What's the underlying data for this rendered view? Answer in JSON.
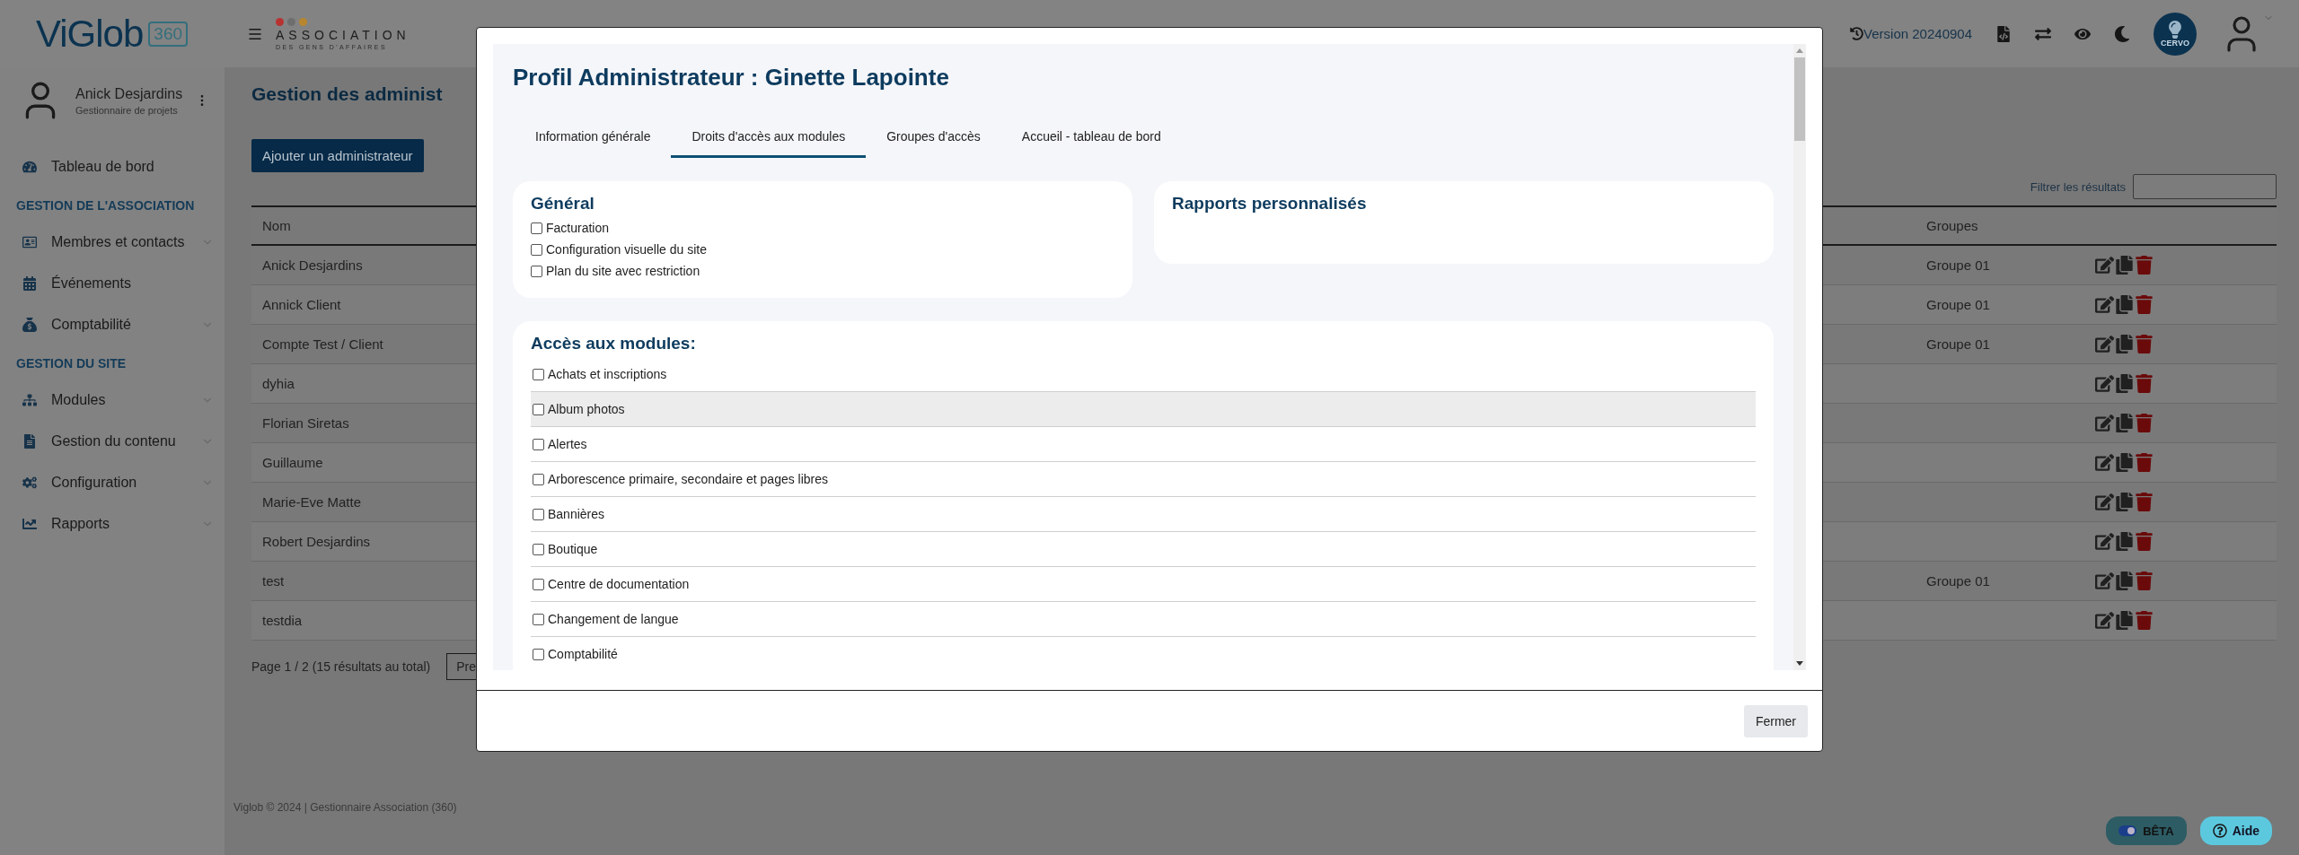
{
  "header": {
    "logo": {
      "name": "ViGlob",
      "badge": "360"
    },
    "org_logo": {
      "title": "ASSOCIATION",
      "subtitle": "DES GENS D'AFFAIRES",
      "dots": [
        {
          "color": "#b83232"
        },
        {
          "color": "#6e6e6e"
        },
        {
          "color": "#b8862e"
        }
      ]
    },
    "version": "Version 20240904",
    "assistant_badge": "CERVO"
  },
  "user": {
    "name": "Anick Desjardins",
    "role": "Gestionnaire de projets"
  },
  "sidebar": {
    "items": [
      {
        "kind": "link",
        "label": "Tableau de bord",
        "expandable": false
      },
      {
        "kind": "section",
        "label": "GESTION DE L'ASSOCIATION"
      },
      {
        "kind": "link",
        "label": "Membres et contacts",
        "expandable": true
      },
      {
        "kind": "link",
        "label": "Événements",
        "expandable": false
      },
      {
        "kind": "link",
        "label": "Comptabilité",
        "expandable": true
      },
      {
        "kind": "section",
        "label": "GESTION DU SITE"
      },
      {
        "kind": "link",
        "label": "Modules",
        "expandable": true
      },
      {
        "kind": "link",
        "label": "Gestion du contenu",
        "expandable": true
      },
      {
        "kind": "link",
        "label": "Configuration",
        "expandable": true
      },
      {
        "kind": "link",
        "label": "Rapports",
        "expandable": true
      }
    ]
  },
  "page": {
    "title": "Gestion des administ",
    "add_button": "Ajouter un administrateur",
    "filter_label": "Filtrer les résultats",
    "table": {
      "columns": [
        "Nom",
        "Groupes"
      ],
      "rows": [
        {
          "name": "Anick Desjardins",
          "group": "Groupe 01"
        },
        {
          "name": "Annick Client",
          "group": "Groupe 01"
        },
        {
          "name": "Compte Test / Client",
          "group": "Groupe 01"
        },
        {
          "name": "dyhia"
        },
        {
          "name": "Florian Siretas"
        },
        {
          "name": "Guillaume"
        },
        {
          "name": "Marie-Eve Matte"
        },
        {
          "name": "Robert Desjardins"
        },
        {
          "name": "test",
          "group": "Groupe 01"
        },
        {
          "name": "testdia"
        }
      ]
    },
    "pagination": {
      "summary": "Page 1 / 2 (15 résultats au total)",
      "prev_button": "Pre"
    }
  },
  "footer": "Viglob © 2024 | Gestionnaire Association (360)",
  "beta_toggle": {
    "label": "BÊTA",
    "on": true
  },
  "help_button": "Aide",
  "modal": {
    "title": "Profil Administrateur : Ginette Lapointe",
    "tabs": [
      {
        "label": "Information générale",
        "selected": false
      },
      {
        "label": "Droits d'accès aux modules",
        "selected": true
      },
      {
        "label": "Groupes d'accès",
        "selected": false
      },
      {
        "label": "Accueil - tableau de bord",
        "selected": false
      }
    ],
    "general": {
      "title": "Général",
      "options": [
        {
          "label": "Facturation",
          "checked": false
        },
        {
          "label": "Configuration visuelle du site",
          "checked": false
        },
        {
          "label": "Plan du site avec restriction",
          "checked": false
        }
      ]
    },
    "reports": {
      "title": "Rapports personnalisés"
    },
    "modules": {
      "title": "Accès aux modules:",
      "items": [
        {
          "label": "Achats et inscriptions",
          "checked": false,
          "hovered": false
        },
        {
          "label": "Album photos",
          "checked": false,
          "hovered": true
        },
        {
          "label": "Alertes",
          "checked": false,
          "hovered": false
        },
        {
          "label": "Arborescence primaire, secondaire et pages libres",
          "checked": false,
          "hovered": false
        },
        {
          "label": "Bannières",
          "checked": false,
          "hovered": false
        },
        {
          "label": "Boutique",
          "checked": false,
          "hovered": false
        },
        {
          "label": "Centre de documentation",
          "checked": false,
          "hovered": false
        },
        {
          "label": "Changement de langue",
          "checked": false,
          "hovered": false
        },
        {
          "label": "Comptabilité",
          "checked": false,
          "hovered": false
        }
      ]
    },
    "close_button": "Fermer"
  }
}
